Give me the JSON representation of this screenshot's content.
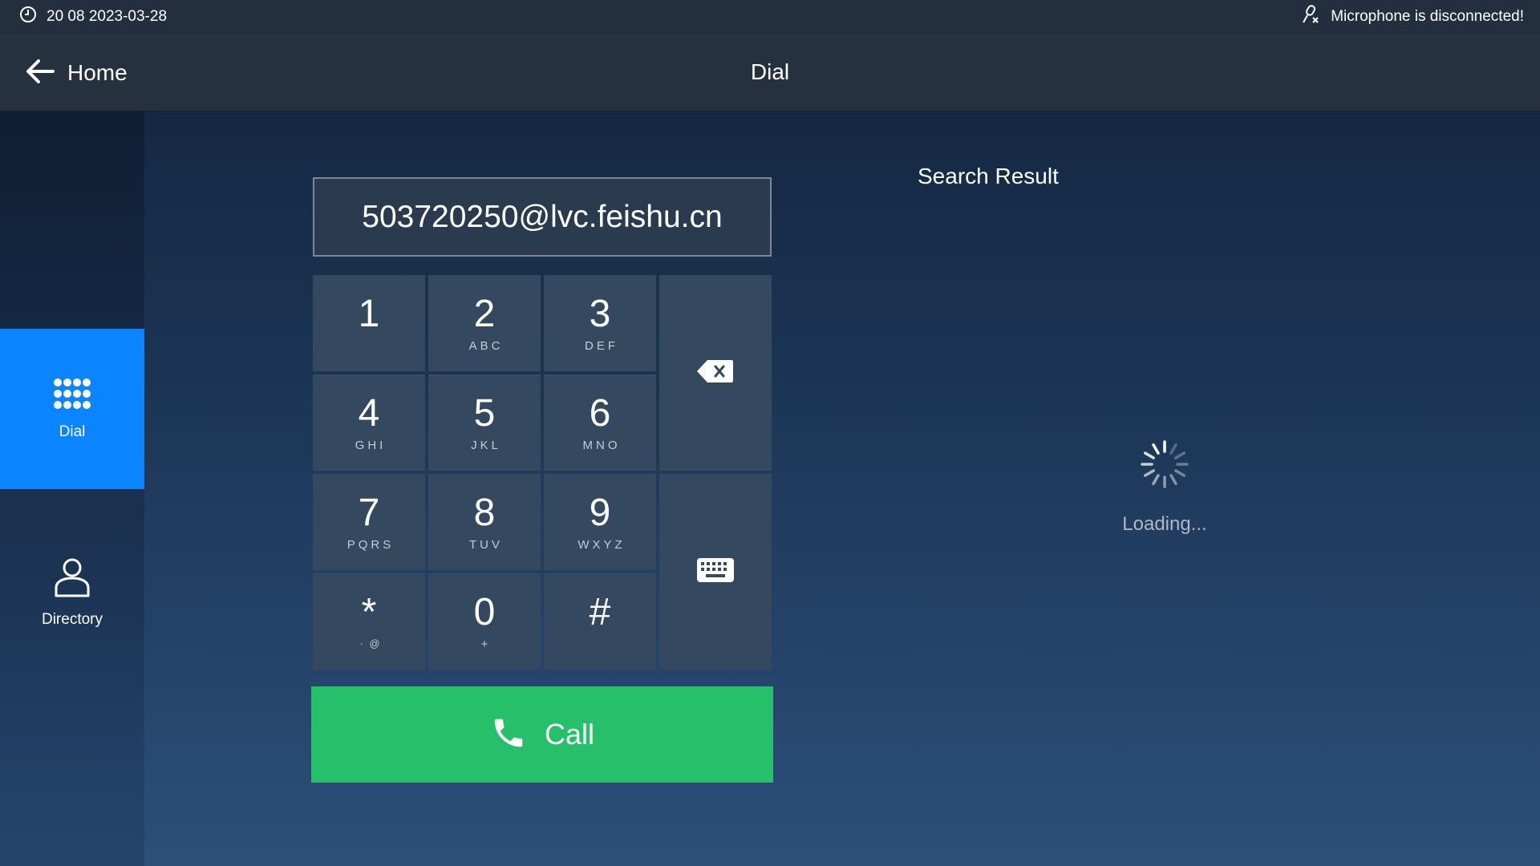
{
  "status_bar": {
    "time": "20 08 2023-03-28",
    "mic_status": "Microphone is disconnected!",
    "icons": [
      "clock-icon",
      "mic-off-icon"
    ]
  },
  "header": {
    "back_label": "Home",
    "title": "Dial"
  },
  "sidebar": {
    "items": [
      {
        "label": "Dial",
        "icon": "dialpad-icon",
        "active": true
      },
      {
        "label": "Directory",
        "icon": "person-icon",
        "active": false
      }
    ]
  },
  "dialer": {
    "number": "503720250@lvc.feishu.cn",
    "keys": [
      {
        "digit": "1",
        "letters": ""
      },
      {
        "digit": "2",
        "letters": "ABC"
      },
      {
        "digit": "3",
        "letters": "DEF"
      },
      {
        "digit": "4",
        "letters": "GHI"
      },
      {
        "digit": "5",
        "letters": "JKL"
      },
      {
        "digit": "6",
        "letters": "MNO"
      },
      {
        "digit": "7",
        "letters": "PQRS"
      },
      {
        "digit": "8",
        "letters": "TUV"
      },
      {
        "digit": "9",
        "letters": "WXYZ"
      },
      {
        "digit": "*",
        "letters": "· @"
      },
      {
        "digit": "0",
        "letters": "+"
      },
      {
        "digit": "#",
        "letters": ""
      }
    ],
    "side_keys": [
      "backspace-icon",
      "keyboard-icon"
    ],
    "call_label": "Call"
  },
  "search": {
    "title": "Search Result",
    "loading_text": "Loading..."
  },
  "colors": {
    "accent": "#0a84ff",
    "call": "#27c06a",
    "key": "#344860",
    "bar": "#232f3e"
  }
}
